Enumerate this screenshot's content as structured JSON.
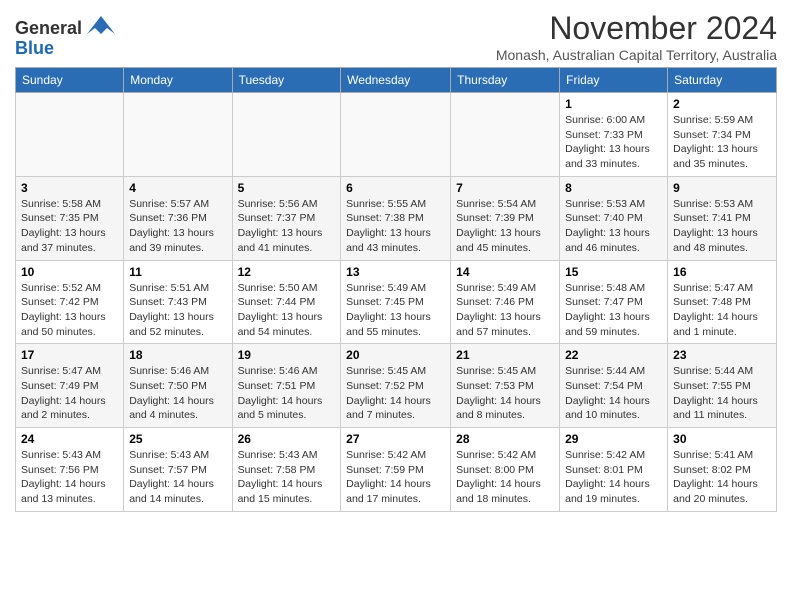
{
  "logo": {
    "general": "General",
    "blue": "Blue"
  },
  "title": "November 2024",
  "subtitle": "Monash, Australian Capital Territory, Australia",
  "weekdays": [
    "Sunday",
    "Monday",
    "Tuesday",
    "Wednesday",
    "Thursday",
    "Friday",
    "Saturday"
  ],
  "weeks": [
    [
      {
        "day": "",
        "info": ""
      },
      {
        "day": "",
        "info": ""
      },
      {
        "day": "",
        "info": ""
      },
      {
        "day": "",
        "info": ""
      },
      {
        "day": "",
        "info": ""
      },
      {
        "day": "1",
        "info": "Sunrise: 6:00 AM\nSunset: 7:33 PM\nDaylight: 13 hours\nand 33 minutes."
      },
      {
        "day": "2",
        "info": "Sunrise: 5:59 AM\nSunset: 7:34 PM\nDaylight: 13 hours\nand 35 minutes."
      }
    ],
    [
      {
        "day": "3",
        "info": "Sunrise: 5:58 AM\nSunset: 7:35 PM\nDaylight: 13 hours\nand 37 minutes."
      },
      {
        "day": "4",
        "info": "Sunrise: 5:57 AM\nSunset: 7:36 PM\nDaylight: 13 hours\nand 39 minutes."
      },
      {
        "day": "5",
        "info": "Sunrise: 5:56 AM\nSunset: 7:37 PM\nDaylight: 13 hours\nand 41 minutes."
      },
      {
        "day": "6",
        "info": "Sunrise: 5:55 AM\nSunset: 7:38 PM\nDaylight: 13 hours\nand 43 minutes."
      },
      {
        "day": "7",
        "info": "Sunrise: 5:54 AM\nSunset: 7:39 PM\nDaylight: 13 hours\nand 45 minutes."
      },
      {
        "day": "8",
        "info": "Sunrise: 5:53 AM\nSunset: 7:40 PM\nDaylight: 13 hours\nand 46 minutes."
      },
      {
        "day": "9",
        "info": "Sunrise: 5:53 AM\nSunset: 7:41 PM\nDaylight: 13 hours\nand 48 minutes."
      }
    ],
    [
      {
        "day": "10",
        "info": "Sunrise: 5:52 AM\nSunset: 7:42 PM\nDaylight: 13 hours\nand 50 minutes."
      },
      {
        "day": "11",
        "info": "Sunrise: 5:51 AM\nSunset: 7:43 PM\nDaylight: 13 hours\nand 52 minutes."
      },
      {
        "day": "12",
        "info": "Sunrise: 5:50 AM\nSunset: 7:44 PM\nDaylight: 13 hours\nand 54 minutes."
      },
      {
        "day": "13",
        "info": "Sunrise: 5:49 AM\nSunset: 7:45 PM\nDaylight: 13 hours\nand 55 minutes."
      },
      {
        "day": "14",
        "info": "Sunrise: 5:49 AM\nSunset: 7:46 PM\nDaylight: 13 hours\nand 57 minutes."
      },
      {
        "day": "15",
        "info": "Sunrise: 5:48 AM\nSunset: 7:47 PM\nDaylight: 13 hours\nand 59 minutes."
      },
      {
        "day": "16",
        "info": "Sunrise: 5:47 AM\nSunset: 7:48 PM\nDaylight: 14 hours\nand 1 minute."
      }
    ],
    [
      {
        "day": "17",
        "info": "Sunrise: 5:47 AM\nSunset: 7:49 PM\nDaylight: 14 hours\nand 2 minutes."
      },
      {
        "day": "18",
        "info": "Sunrise: 5:46 AM\nSunset: 7:50 PM\nDaylight: 14 hours\nand 4 minutes."
      },
      {
        "day": "19",
        "info": "Sunrise: 5:46 AM\nSunset: 7:51 PM\nDaylight: 14 hours\nand 5 minutes."
      },
      {
        "day": "20",
        "info": "Sunrise: 5:45 AM\nSunset: 7:52 PM\nDaylight: 14 hours\nand 7 minutes."
      },
      {
        "day": "21",
        "info": "Sunrise: 5:45 AM\nSunset: 7:53 PM\nDaylight: 14 hours\nand 8 minutes."
      },
      {
        "day": "22",
        "info": "Sunrise: 5:44 AM\nSunset: 7:54 PM\nDaylight: 14 hours\nand 10 minutes."
      },
      {
        "day": "23",
        "info": "Sunrise: 5:44 AM\nSunset: 7:55 PM\nDaylight: 14 hours\nand 11 minutes."
      }
    ],
    [
      {
        "day": "24",
        "info": "Sunrise: 5:43 AM\nSunset: 7:56 PM\nDaylight: 14 hours\nand 13 minutes."
      },
      {
        "day": "25",
        "info": "Sunrise: 5:43 AM\nSunset: 7:57 PM\nDaylight: 14 hours\nand 14 minutes."
      },
      {
        "day": "26",
        "info": "Sunrise: 5:43 AM\nSunset: 7:58 PM\nDaylight: 14 hours\nand 15 minutes."
      },
      {
        "day": "27",
        "info": "Sunrise: 5:42 AM\nSunset: 7:59 PM\nDaylight: 14 hours\nand 17 minutes."
      },
      {
        "day": "28",
        "info": "Sunrise: 5:42 AM\nSunset: 8:00 PM\nDaylight: 14 hours\nand 18 minutes."
      },
      {
        "day": "29",
        "info": "Sunrise: 5:42 AM\nSunset: 8:01 PM\nDaylight: 14 hours\nand 19 minutes."
      },
      {
        "day": "30",
        "info": "Sunrise: 5:41 AM\nSunset: 8:02 PM\nDaylight: 14 hours\nand 20 minutes."
      }
    ]
  ]
}
